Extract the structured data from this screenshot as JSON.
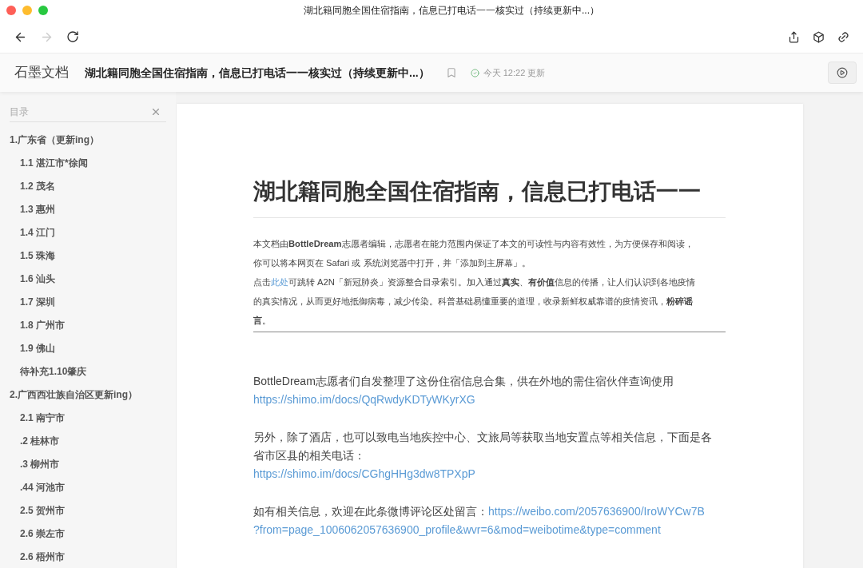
{
  "window": {
    "title": "湖北籍同胞全国住宿指南，信息已打电话一一核实过（持续更新中...）"
  },
  "header": {
    "logo": "石墨文档",
    "doc_title": "湖北籍同胞全国住宿指南，信息已打电话一一核实过（持续更新中...）",
    "saved": "今天 12:22 更新"
  },
  "toc": {
    "title": "目录",
    "items": [
      {
        "label": "1.广东省（更新ing）",
        "children": [
          {
            "label": "1.1 湛江市*徐闻"
          },
          {
            "label": "1.2 茂名"
          },
          {
            "label": "1.3 惠州"
          },
          {
            "label": "1.4 江门"
          },
          {
            "label": "1.5 珠海"
          },
          {
            "label": "1.6 汕头"
          },
          {
            "label": "1.7 深圳"
          },
          {
            "label": "1.8 广州市"
          },
          {
            "label": "1.9 佛山"
          },
          {
            "label": "待补充1.10肇庆"
          }
        ]
      },
      {
        "label": "2.广西西壮族自治区更新ing）",
        "children": [
          {
            "label": "2.1 南宁市"
          },
          {
            "label": ".2 桂林市"
          },
          {
            "label": ".3 柳州市"
          },
          {
            "label": ".44 河池市"
          },
          {
            "label": "2.5 贺州市"
          },
          {
            "label": "2.6 崇左市"
          },
          {
            "label": "2.6 梧州市"
          }
        ]
      }
    ]
  },
  "document": {
    "heading": "湖北籍同胞全国住宿指南，信息已打电话一一",
    "intro": [
      [
        {
          "kind": "text",
          "text": "本文档由**BottleDream**志愿者编辑，志愿者在能力范围内保证了本文的可读性与内容有效性，为方便保存和阅读，"
        }
      ],
      [
        {
          "kind": "text",
          "text": "你可以将本网页在 Safari 或 系统浏览器中打开，并「添加到主屏幕」。"
        }
      ],
      [
        {
          "kind": "text",
          "text": "点击"
        },
        {
          "kind": "link",
          "text": "此处"
        },
        {
          "kind": "text",
          "text": "可跳转 A2N「新冠肺炎」资源整合目录索引。加入通过**真实**、**有价值**信息的传播，让人们认识到各地疫情"
        }
      ],
      [
        {
          "kind": "text",
          "text": "的真实情况，从而更好地抵御病毒，减少传染。科普基础易懂重要的道理，收录新鲜权威靠谱的疫情资讯，**粉碎谣**"
        }
      ],
      [
        {
          "kind": "text",
          "text": "**言**。"
        }
      ]
    ],
    "paragraphs": [
      [
        [
          {
            "kind": "text",
            "text": "BottleDream志愿者们自发整理了这份住宿信息合集，供在外地的需住宿伙伴查询使用"
          }
        ],
        [
          {
            "kind": "link",
            "text": "https://shimo.im/docs/QqRwdyKDTyWKyrXG"
          }
        ]
      ],
      [
        [
          {
            "kind": "text",
            "text": "另外，除了酒店，也可以致电当地疾控中心、文旅局等获取当地安置点等相关信息，下面是各"
          }
        ],
        [
          {
            "kind": "text",
            "text": "省市区县的相关电话："
          }
        ],
        [
          {
            "kind": "link",
            "text": "https://shimo.im/docs/CGhgHHg3dw8TPXpP"
          }
        ]
      ],
      [
        [
          {
            "kind": "text",
            "text": "如有相关信息，欢迎在此条微博评论区处留言："
          },
          {
            "kind": "link",
            "text": "https://weibo.com/2057636900/IroWYCw7B"
          }
        ],
        [
          {
            "kind": "link",
            "text": "?from=page_1006062057636900_profile&wvr=6&mod=weibotime&type=comment"
          }
        ]
      ]
    ]
  }
}
